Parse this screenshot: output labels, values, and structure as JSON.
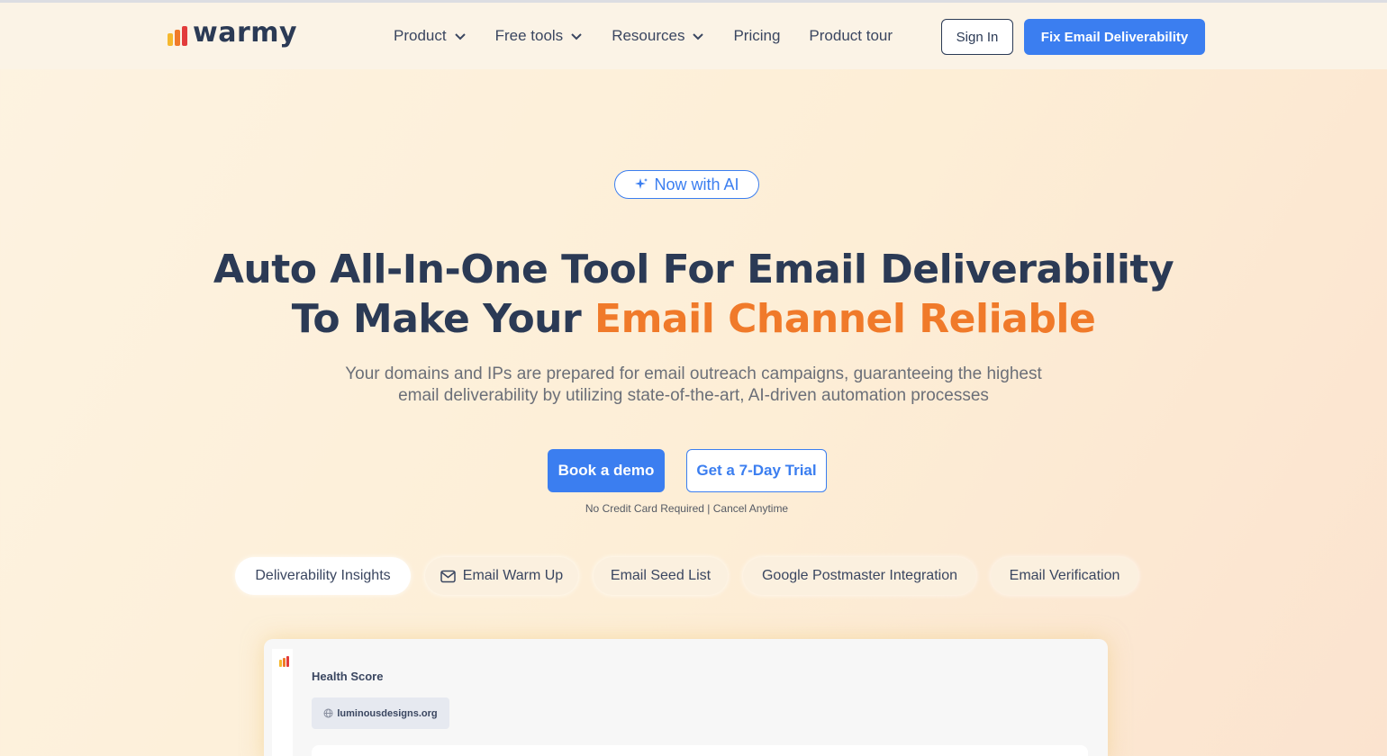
{
  "header": {
    "logo_text": "warmy",
    "brand_colors": [
      "#f5b82e",
      "#f07a2a",
      "#e23b3b"
    ],
    "nav": [
      {
        "label": "Product",
        "has_dropdown": true
      },
      {
        "label": "Free tools",
        "has_dropdown": true
      },
      {
        "label": "Resources",
        "has_dropdown": true
      },
      {
        "label": "Pricing",
        "has_dropdown": false
      },
      {
        "label": "Product tour",
        "has_dropdown": false
      }
    ],
    "signin_label": "Sign In",
    "cta_label": "Fix Email Deliverability"
  },
  "hero": {
    "badge": "Now with AI",
    "title_line1": "Auto All-In-One Tool For Email Deliverability",
    "title_line2_prefix": "To Make Your ",
    "title_line2_accent": "Email Channel Reliable",
    "subtitle_line1": "Your domains and IPs are prepared for email outreach campaigns, guaranteeing the highest",
    "subtitle_line2": "email deliverability by utilizing state-of-the-art, AI-driven automation processes",
    "demo_label": "Book a demo",
    "trial_label": "Get a 7-Day Trial",
    "note": "No Credit Card Required | Cancel Anytime"
  },
  "tabs": [
    {
      "label": "Deliverability Insights",
      "active": true,
      "icon": ""
    },
    {
      "label": "Email Warm Up",
      "active": false,
      "icon": "mail-icon"
    },
    {
      "label": "Email Seed List",
      "active": false,
      "icon": ""
    },
    {
      "label": "Google Postmaster Integration",
      "active": false,
      "icon": ""
    },
    {
      "label": "Email Verification",
      "active": false,
      "icon": ""
    }
  ],
  "preview": {
    "title": "Health Score",
    "domain": "luminousdesigns.org"
  },
  "colors": {
    "accent": "#3b7ef0",
    "highlight": "#f07a2a",
    "text": "#2b3a55"
  }
}
